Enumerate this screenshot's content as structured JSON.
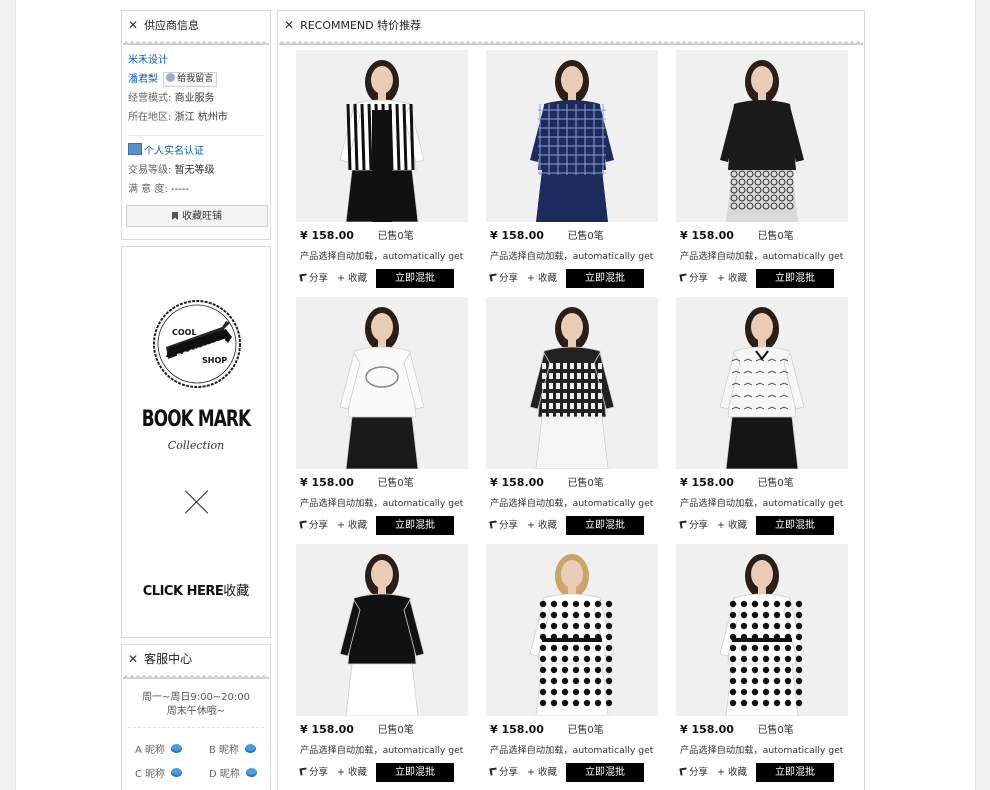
{
  "supplier": {
    "title": "供应商信息",
    "shop_name": "米禾设计",
    "contact": "潘君梨",
    "leave_message": "给我留言",
    "mode_key": "经营模式:",
    "mode_val": "商业服务",
    "region_key": "所在地区:",
    "region_val": "浙江 杭州市",
    "auth": "个人实名认证",
    "level_key": "交易等级:",
    "level_val": "暂无等级",
    "satisfaction_key": "满 意 度:",
    "satisfaction_val": "-----",
    "fav_shop": "收藏旺铺"
  },
  "banner": {
    "badge_top": "COOL",
    "badge_mid": "BOOK MARK",
    "badge_bottom": "SHOP",
    "title": "BOOK MARK",
    "subtitle": "Collection",
    "click_here": "CLICK HERE",
    "click_cn": "收藏"
  },
  "service": {
    "title": "客服中心",
    "hours1": "周一~周日9:00~20:00",
    "hours2": "周末午休哦~",
    "agents": [
      "A 昵称",
      "B 昵称",
      "C 昵称",
      "D 昵称"
    ]
  },
  "recommend": {
    "title": "RECOMMEND 特价推荐",
    "share": "分享",
    "collect": "收藏",
    "buy": "立即混批",
    "products": [
      {
        "price": "¥ 158.00",
        "sold": "已售0笔",
        "desc": "产品选择自动加载，automatically get",
        "outfit": "striped-blazer"
      },
      {
        "price": "¥ 158.00",
        "sold": "已售0笔",
        "desc": "产品选择自动加载，automatically get",
        "outfit": "navy-plaid-shirt"
      },
      {
        "price": "¥ 158.00",
        "sold": "已售0笔",
        "desc": "产品选择自动加载，automatically get",
        "outfit": "black-lace-top"
      },
      {
        "price": "¥ 158.00",
        "sold": "已售0笔",
        "desc": "产品选择自动加载，automatically get",
        "outfit": "white-print-top"
      },
      {
        "price": "¥ 158.00",
        "sold": "已售0笔",
        "desc": "产品选择自动加载，automatically get",
        "outfit": "letter-knit-top"
      },
      {
        "price": "¥ 158.00",
        "sold": "已售0笔",
        "desc": "产品选择自动加载，automatically get",
        "outfit": "white-bow-blouse"
      },
      {
        "price": "¥ 158.00",
        "sold": "已售0笔",
        "desc": "产品选择自动加载，automatically get",
        "outfit": "black-pleat-blouse"
      },
      {
        "price": "¥ 158.00",
        "sold": "已售0笔",
        "desc": "产品选择自动加载，automatically get",
        "outfit": "polka-dot-dress"
      },
      {
        "price": "¥ 158.00",
        "sold": "已售0笔",
        "desc": "产品选择自动加载，automatically get",
        "outfit": "polka-dot-blouse"
      }
    ]
  }
}
